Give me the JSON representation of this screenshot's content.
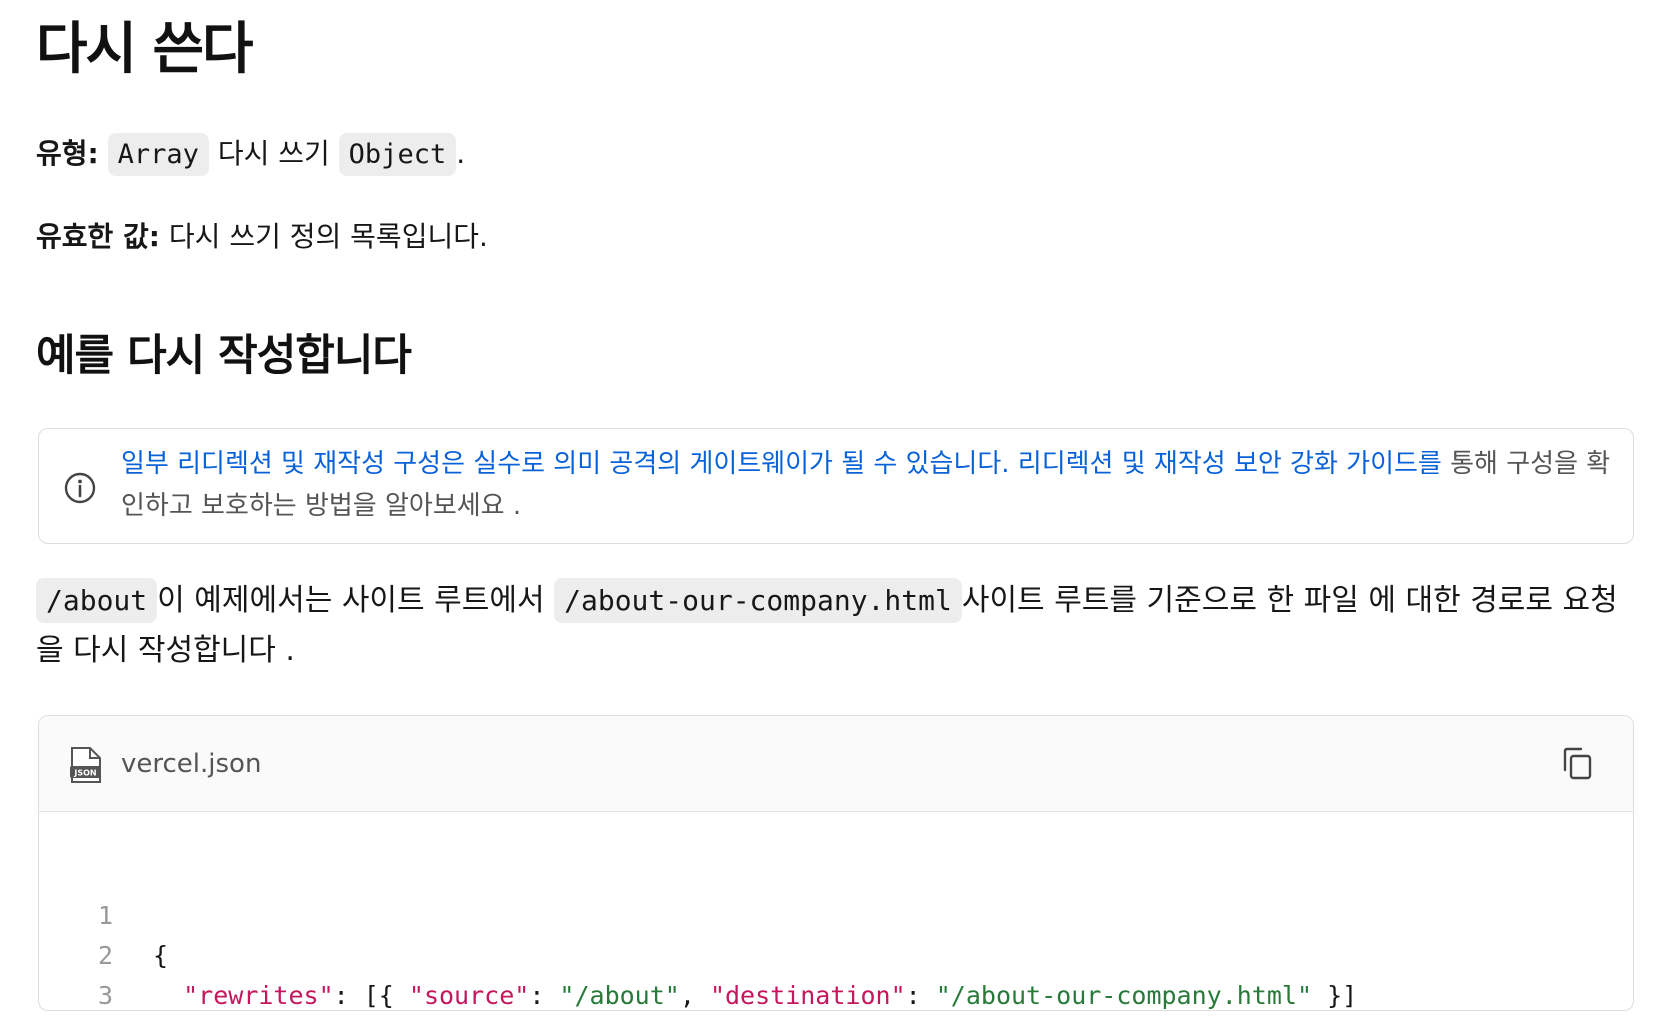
{
  "page": {
    "title": "다시 쓴다",
    "type_label": "유형:",
    "type_code_1": "Array",
    "type_mid": "다시 쓰기",
    "type_code_2": "Object",
    "type_end": ".",
    "valid_label": "유효한 값:",
    "valid_text": "다시 쓰기 정의 목록입니다.",
    "section_heading": "예를 다시 작성합니다"
  },
  "callout": {
    "icon": "info-icon",
    "link_text": "일부 리디렉션 및 재작성 구성은 실수로 의미 공격의 게이트웨이가 될 수 있습니다. 리디렉션 및 재작성 보안 강화 가이드를",
    "rest_text": "통해 구성을 확인하고 보호하는 방법을 알아보세요 ."
  },
  "description": {
    "code_1": "/about",
    "text_1": "이 예제에서는 사이트 루트에서",
    "code_2": "/about-our-company.html",
    "text_2": "사이트 루트를 기준으로 한 파일 에 대한 경로로 요청을 다시 작성합니다 ."
  },
  "code_block": {
    "file_icon": "json-file-icon",
    "filename": "vercel.json",
    "copy_icon": "copy-icon",
    "line_numbers": [
      "1",
      "2",
      "3"
    ],
    "line1": "{",
    "l2_indent": "  ",
    "l2_key_rewrites": "\"rewrites\"",
    "l2_p1": ": [{ ",
    "l2_key_source": "\"source\"",
    "l2_p2": ": ",
    "l2_val_source": "\"/about\"",
    "l2_p3": ", ",
    "l2_key_destination": "\"destination\"",
    "l2_p4": ": ",
    "l2_val_destination": "\"/about-our-company.html\"",
    "l2_p5": " }]",
    "line3": "}"
  }
}
